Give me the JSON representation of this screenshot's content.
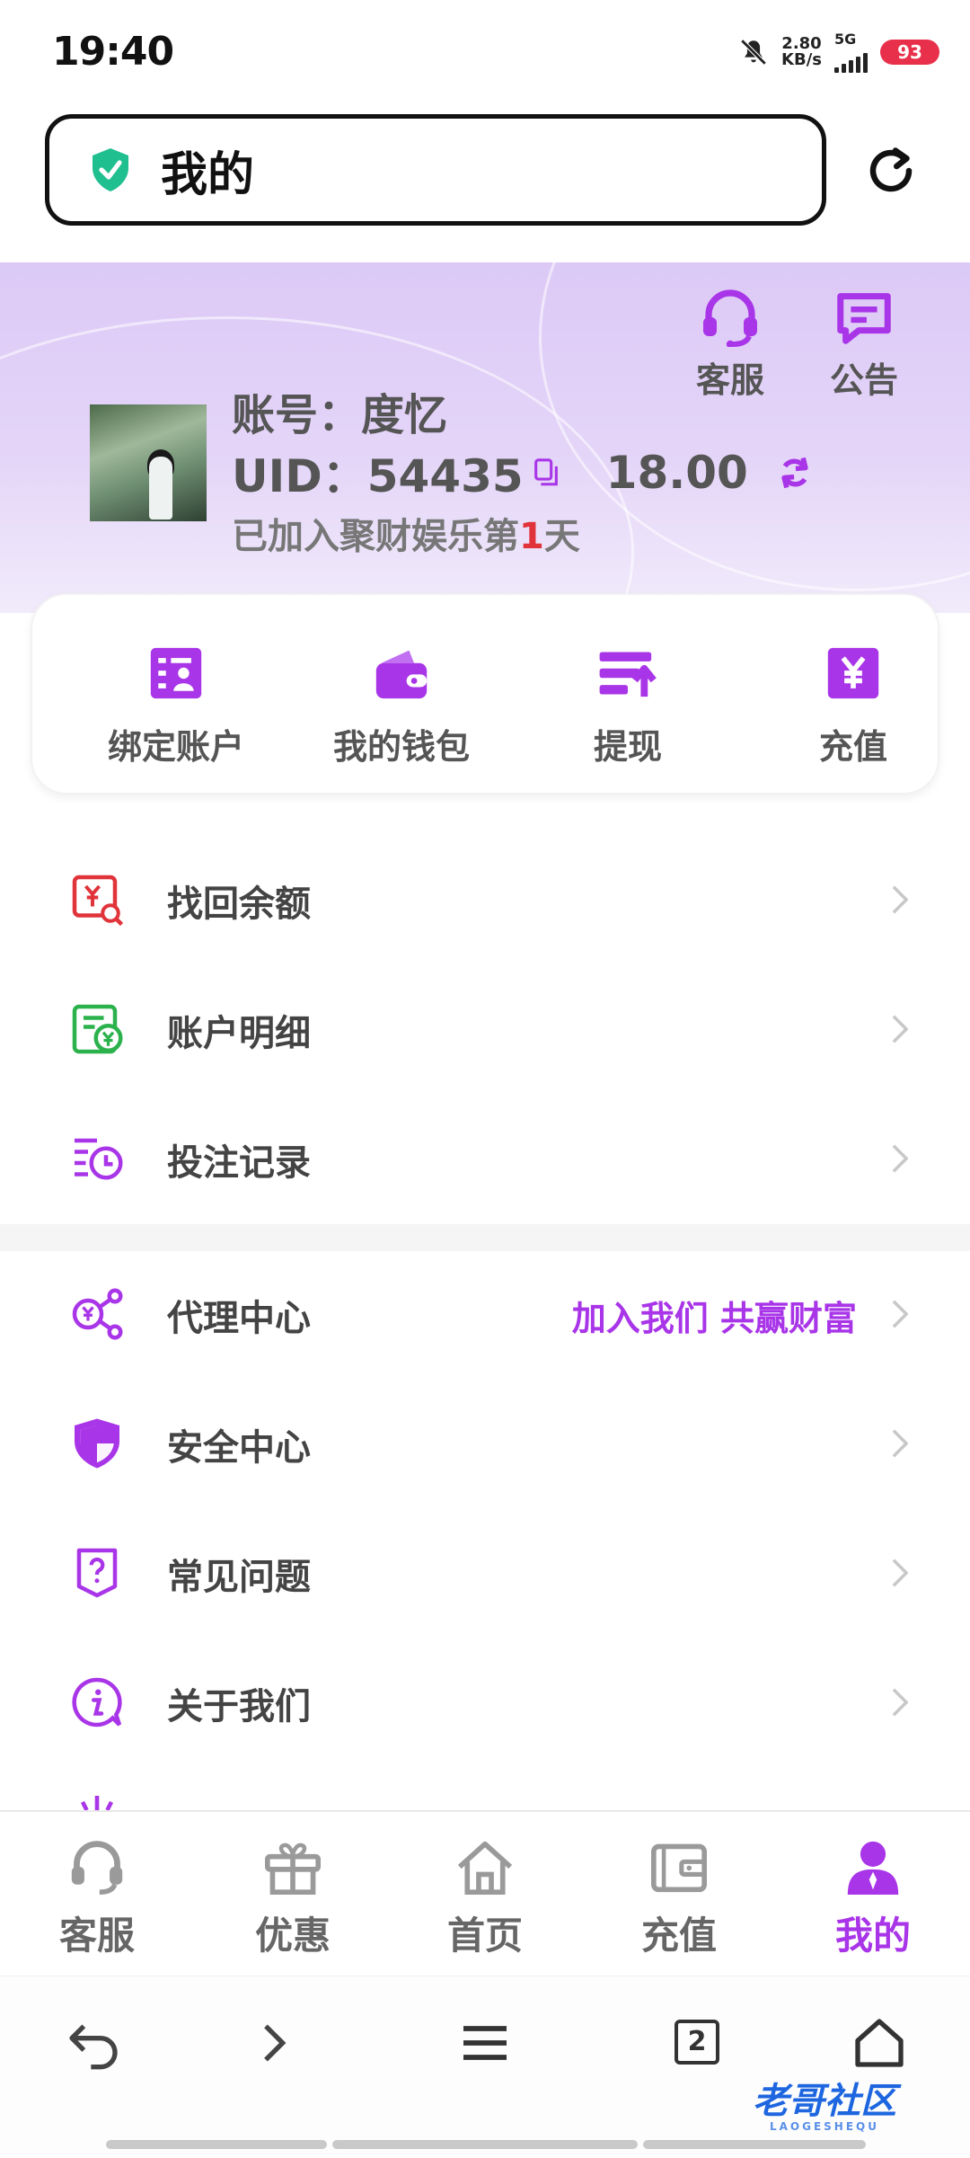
{
  "status_bar": {
    "time": "19:40",
    "speed_top": "2.80",
    "speed_bottom": "KB/s",
    "network": "5G",
    "battery": "93"
  },
  "address_bar": {
    "title": "我的"
  },
  "header": {
    "service_label": "客服",
    "notice_label": "公告",
    "account_text": "账号：度忆",
    "uid_text": "UID：54435",
    "balance": "18.00",
    "joined_prefix": "已加入聚财娱乐第",
    "joined_days": "1",
    "joined_suffix": "天"
  },
  "quick_actions": [
    {
      "label": "绑定账户",
      "icon": "bind-account-icon"
    },
    {
      "label": "我的钱包",
      "icon": "wallet-icon"
    },
    {
      "label": "提现",
      "icon": "withdraw-icon"
    },
    {
      "label": "充值",
      "icon": "recharge-icon"
    }
  ],
  "menu": [
    {
      "label": "找回余额",
      "icon": "recover-balance-icon",
      "color": "#e0333a"
    },
    {
      "label": "账户明细",
      "icon": "account-details-icon",
      "color": "#2bb24c"
    },
    {
      "label": "投注记录",
      "icon": "bet-records-icon",
      "color": "#a935e8"
    },
    {
      "label": "代理中心",
      "icon": "agent-center-icon",
      "extra": "加入我们 共赢财富",
      "color": "#a935e8"
    },
    {
      "label": "安全中心",
      "icon": "security-center-icon",
      "color": "#a935e8"
    },
    {
      "label": "常见问题",
      "icon": "faq-icon",
      "color": "#a935e8"
    },
    {
      "label": "关于我们",
      "icon": "about-us-icon",
      "color": "#a935e8"
    }
  ],
  "tabs": [
    {
      "label": "客服",
      "icon": "headset-icon"
    },
    {
      "label": "优惠",
      "icon": "gift-icon"
    },
    {
      "label": "首页",
      "icon": "home-icon"
    },
    {
      "label": "充值",
      "icon": "wallet-card-icon"
    },
    {
      "label": "我的",
      "icon": "user-icon",
      "active": true
    }
  ],
  "system_nav": {
    "tab_count": "2",
    "watermark": "老哥社区",
    "watermark_sub": "LAOGESHEQU"
  },
  "colors": {
    "accent": "#a935e8",
    "header_bg": "#dcc9f6",
    "shield": "#1fbf8f",
    "red": "#e0333a",
    "green": "#2bb24c"
  }
}
